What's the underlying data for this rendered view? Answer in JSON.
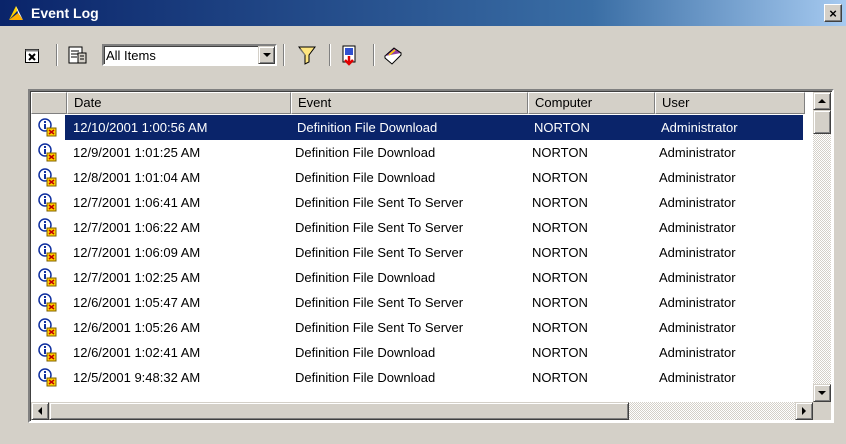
{
  "window": {
    "title": "Event Log",
    "close_label": "×"
  },
  "toolbar": {
    "filter_value": "All Items",
    "buttons": [
      "delete-icon",
      "properties-icon",
      "filter-icon",
      "save-icon",
      "book-icon"
    ]
  },
  "table": {
    "columns": [
      "",
      "Date",
      "Event",
      "Computer",
      "User"
    ],
    "rows": [
      {
        "date": "12/10/2001 1:00:56 AM",
        "event": "Definition File Download",
        "computer": "NORTON",
        "user": "Administrator",
        "selected": true
      },
      {
        "date": "12/9/2001 1:01:25 AM",
        "event": "Definition File Download",
        "computer": "NORTON",
        "user": "Administrator"
      },
      {
        "date": "12/8/2001 1:01:04 AM",
        "event": "Definition File Download",
        "computer": "NORTON",
        "user": "Administrator"
      },
      {
        "date": "12/7/2001 1:06:41 AM",
        "event": "Definition File Sent To Server",
        "computer": "NORTON",
        "user": "Administrator"
      },
      {
        "date": "12/7/2001 1:06:22 AM",
        "event": "Definition File Sent To Server",
        "computer": "NORTON",
        "user": "Administrator"
      },
      {
        "date": "12/7/2001 1:06:09 AM",
        "event": "Definition File Sent To Server",
        "computer": "NORTON",
        "user": "Administrator"
      },
      {
        "date": "12/7/2001 1:02:25 AM",
        "event": "Definition File Download",
        "computer": "NORTON",
        "user": "Administrator"
      },
      {
        "date": "12/6/2001 1:05:47 AM",
        "event": "Definition File Sent To Server",
        "computer": "NORTON",
        "user": "Administrator"
      },
      {
        "date": "12/6/2001 1:05:26 AM",
        "event": "Definition File Sent To Server",
        "computer": "NORTON",
        "user": "Administrator"
      },
      {
        "date": "12/6/2001 1:02:41 AM",
        "event": "Definition File Download",
        "computer": "NORTON",
        "user": "Administrator"
      },
      {
        "date": "12/5/2001 9:48:32 AM",
        "event": "Definition File Download",
        "computer": "NORTON",
        "user": "Administrator"
      }
    ]
  },
  "colors": {
    "selection": "#0a246a",
    "title_bar": "#0a246a",
    "face": "#d4d0c8"
  }
}
